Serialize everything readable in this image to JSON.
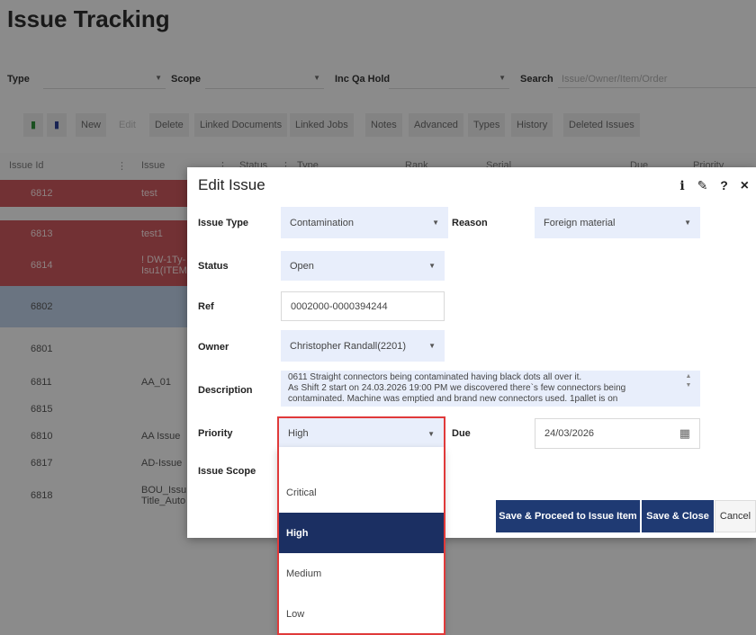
{
  "page": {
    "title": "Issue Tracking"
  },
  "filters": {
    "type_label": "Type",
    "scope_label": "Scope",
    "incqa_label": "Inc Qa Hold",
    "search_label": "Search",
    "search_placeholder": "Issue/Owner/Item/Order"
  },
  "toolbar": {
    "icons": [
      "spreadsheet-export-icon",
      "document-icon"
    ],
    "buttons": [
      "New",
      "Edit",
      "Delete",
      "Linked Documents",
      "Linked Jobs",
      "Notes",
      "Advanced",
      "Types",
      "History",
      "Deleted Issues"
    ]
  },
  "grid": {
    "headers": [
      "Issue Id",
      "Issue",
      "Status",
      "Type",
      "Rank",
      "Serial",
      "Due",
      "Priority"
    ],
    "rows": [
      {
        "id": "6812",
        "issue": "test",
        "style": "red"
      },
      {
        "id": "6813",
        "issue": "test1",
        "style": "red"
      },
      {
        "id": "6814",
        "issue": "! DW-1Ty- Isu1(ITEM",
        "style": "red"
      },
      {
        "id": "6802",
        "issue": "",
        "style": "blue"
      },
      {
        "id": "6801",
        "issue": "",
        "style": "plain"
      },
      {
        "id": "6811",
        "issue": "AA_01",
        "style": "plain"
      },
      {
        "id": "6815",
        "issue": "",
        "style": "plain"
      },
      {
        "id": "6810",
        "issue": "AA Issue",
        "style": "plain"
      },
      {
        "id": "6817",
        "issue": "AD-Issue",
        "style": "plain"
      },
      {
        "id": "6818",
        "issue": "BOU_Issu Title_Auto",
        "style": "plain"
      }
    ]
  },
  "modal": {
    "title": "Edit Issue",
    "header_icons": {
      "info": "i",
      "edit": "✎",
      "help": "?",
      "close": "×"
    },
    "fields": {
      "issue_type": {
        "label": "Issue Type",
        "value": "Contamination"
      },
      "reason": {
        "label": "Reason",
        "value": "Foreign material"
      },
      "status": {
        "label": "Status",
        "value": "Open"
      },
      "ref": {
        "label": "Ref",
        "value": "0002000-0000394244"
      },
      "owner": {
        "label": "Owner",
        "value": "Christopher Randall(2201)"
      },
      "description": {
        "label": "Description",
        "line1": "0611 Straight connectors being contaminated having black dots all over it.",
        "line2": "As Shift 2 start on 24.03.2026 19:00 PM we discovered there`s few connectors being",
        "line3": "contaminated. Machine was emptied and brand new connectors used. 1pallet is on"
      },
      "priority": {
        "label": "Priority",
        "value": "High"
      },
      "due": {
        "label": "Due",
        "value": "24/03/2026"
      },
      "issue_scope": {
        "label": "Issue Scope"
      }
    },
    "buttons": {
      "save_proceed": "Save & Proceed to Issue Item",
      "save_close": "Save & Close",
      "cancel": "Cancel"
    }
  },
  "priority_dropdown": {
    "options": [
      "Critical",
      "High",
      "Medium",
      "Low"
    ],
    "selected": "High"
  },
  "colors": {
    "row_red": "#c4555a",
    "row_blue": "#b7c8de",
    "primary": "#1f3a73",
    "selected_option": "#1b2f62",
    "highlight_border": "#e03a3a",
    "field_bg": "#e8eefb"
  }
}
